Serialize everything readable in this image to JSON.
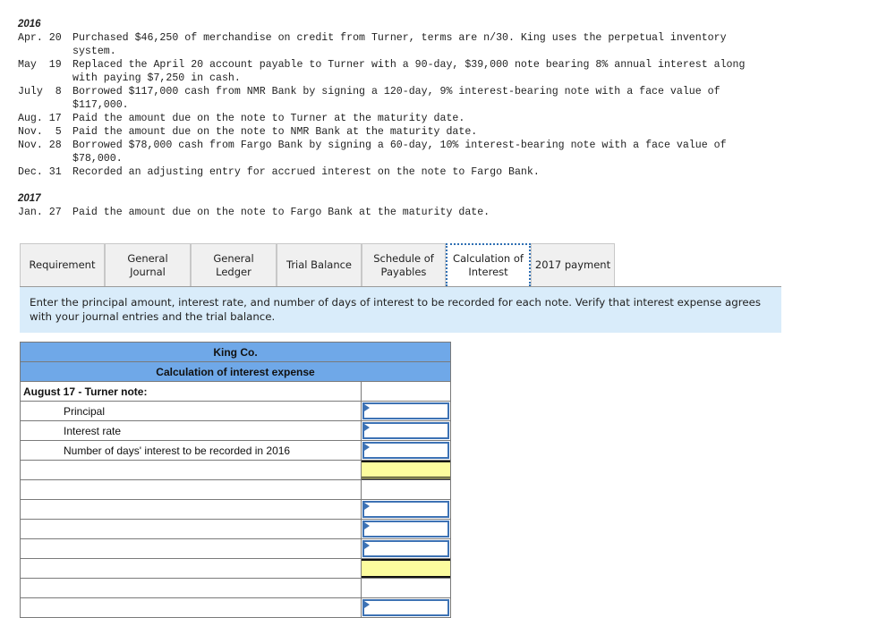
{
  "problem": {
    "years": [
      {
        "year": "2016",
        "entries": [
          {
            "date": "Apr. 20",
            "text": "Purchased $46,250 of merchandise on credit from Turner, terms are n/30. King uses the perpetual inventory\nsystem."
          },
          {
            "date": "May  19",
            "text": "Replaced the April 20 account payable to Turner with a 90-day, $39,000 note bearing 8% annual interest along\nwith paying $7,250 in cash."
          },
          {
            "date": "July  8",
            "text": "Borrowed $117,000 cash from NMR Bank by signing a 120-day, 9% interest-bearing note with a face value of\n$117,000."
          },
          {
            "date": "Aug. 17",
            "text": "Paid the amount due on the note to Turner at the maturity date."
          },
          {
            "date": "Nov.  5",
            "text": "Paid the amount due on the note to NMR Bank at the maturity date."
          },
          {
            "date": "Nov. 28",
            "text": "Borrowed $78,000 cash from Fargo Bank by signing a 60-day, 10% interest-bearing note with a face value of\n$78,000."
          },
          {
            "date": "Dec. 31",
            "text": "Recorded an adjusting entry for accrued interest on the note to Fargo Bank."
          }
        ]
      },
      {
        "year": "2017",
        "entries": [
          {
            "date": "Jan. 27",
            "text": "Paid the amount due on the note to Fargo Bank at the maturity date."
          }
        ]
      }
    ]
  },
  "tabs": [
    {
      "label": "Requirement",
      "active": false
    },
    {
      "label": "General\nJournal",
      "active": false
    },
    {
      "label": "General\nLedger",
      "active": false
    },
    {
      "label": "Trial Balance",
      "active": false
    },
    {
      "label": "Schedule of\nPayables",
      "active": false
    },
    {
      "label": "Calculation of\nInterest",
      "active": true
    },
    {
      "label": "2017 payment",
      "active": false
    }
  ],
  "instructions": "Enter the principal amount, interest rate, and number of days of interest to be recorded for each note.  Verify that interest expense agrees with your journal entries and the trial balance.",
  "table": {
    "company": "King Co.",
    "title": "Calculation of interest expense",
    "section_label": "August 17 - Turner note:",
    "rows": {
      "principal": "Principal",
      "interest_rate": "Interest rate",
      "days": "Number of days' interest to be recorded in 2016"
    },
    "inputs": {
      "principal": "",
      "interest_rate": "",
      "days": "",
      "total": "",
      "row2_1": "",
      "row2_2": "",
      "row2_3": "",
      "total2": "",
      "row3_1": ""
    },
    "colors": {
      "header_bg": "#6fa8e8",
      "total_bg": "#fcfc9e",
      "input_border": "#3d72b4"
    }
  }
}
